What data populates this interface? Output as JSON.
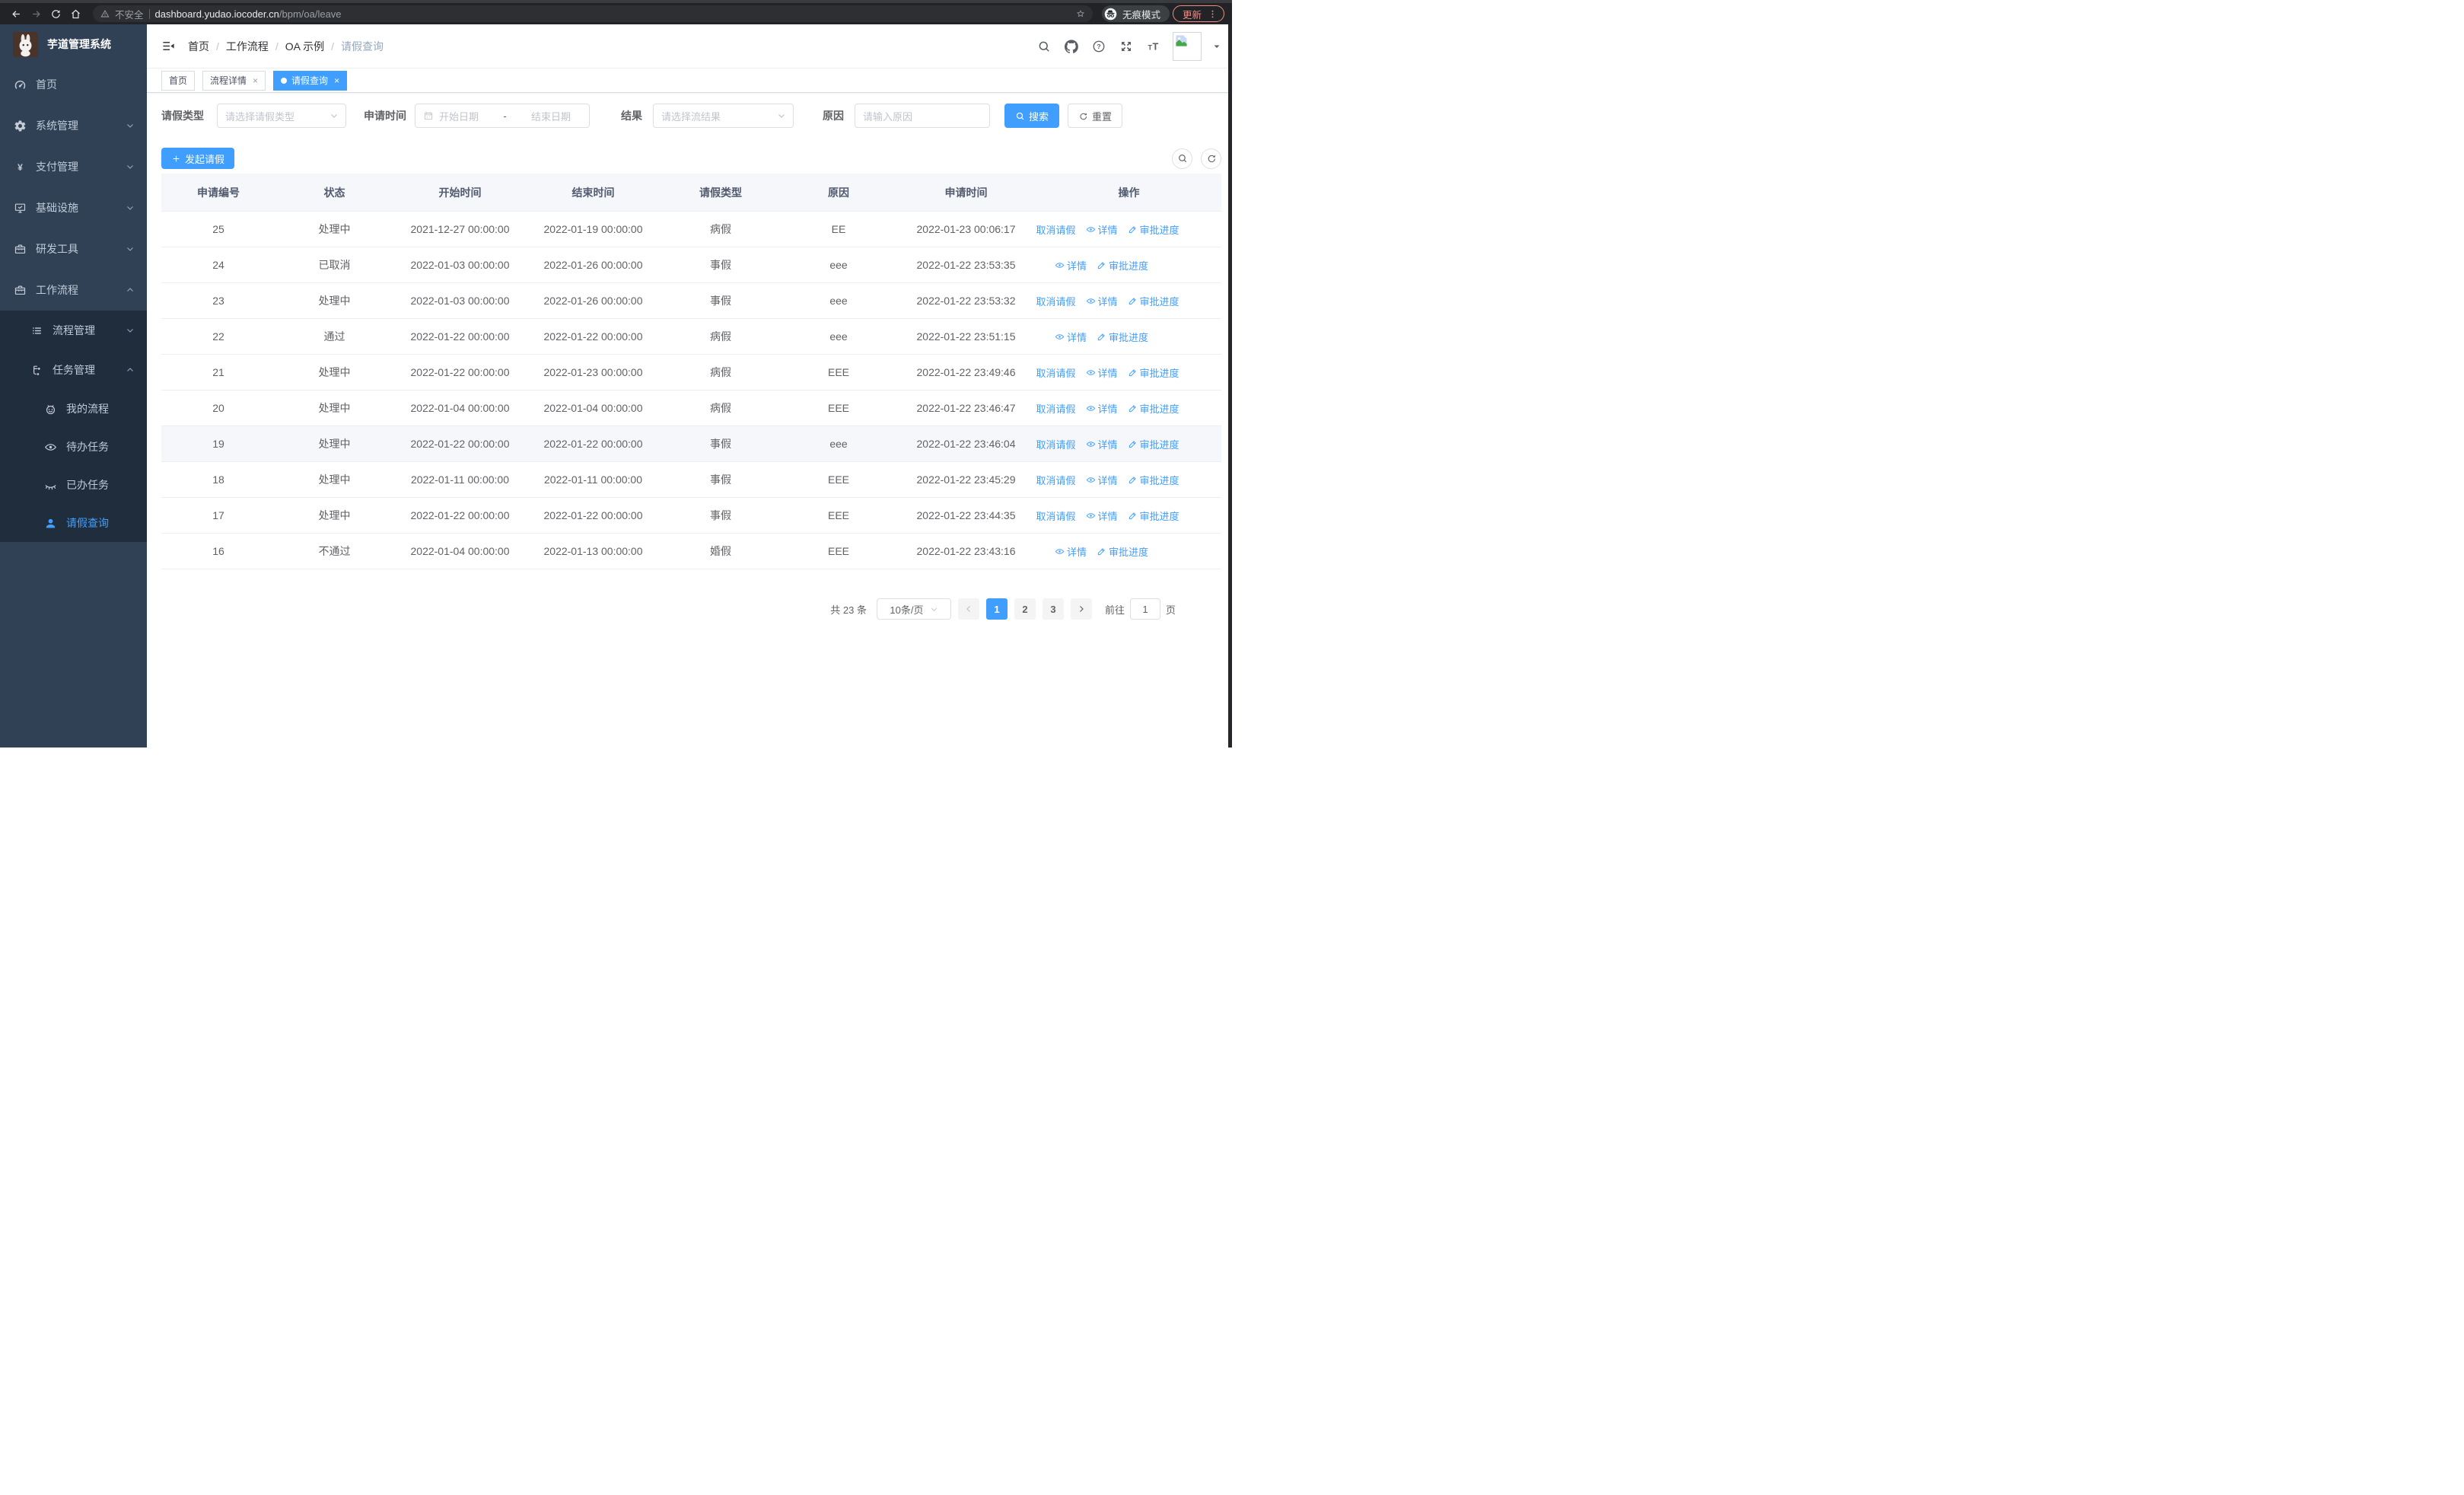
{
  "browser": {
    "security_label": "不安全",
    "url_host": "dashboard.yudao.iocoder.cn",
    "url_path": "/bpm/oa/leave",
    "incognito_label": "无痕模式",
    "update_label": "更新"
  },
  "sidebar": {
    "title": "芋道管理系统",
    "menu": [
      {
        "label": "首页",
        "icon": "dashboard-icon",
        "level": 1,
        "chevron": null,
        "insub": false,
        "active": false
      },
      {
        "label": "系统管理",
        "icon": "gear-icon",
        "level": 1,
        "chevron": "down",
        "insub": false,
        "active": false
      },
      {
        "label": "支付管理",
        "icon": "yen-icon",
        "level": 1,
        "chevron": "down",
        "insub": false,
        "active": false
      },
      {
        "label": "基础设施",
        "icon": "monitor-icon",
        "level": 1,
        "chevron": "down",
        "insub": false,
        "active": false
      },
      {
        "label": "研发工具",
        "icon": "toolbox-icon",
        "level": 1,
        "chevron": "down",
        "insub": false,
        "active": false
      },
      {
        "label": "工作流程",
        "icon": "toolbox-icon",
        "level": 1,
        "chevron": "up",
        "insub": false,
        "active": false
      },
      {
        "label": "流程管理",
        "icon": "list-icon",
        "level": 2,
        "chevron": "down",
        "insub": true,
        "active": false
      },
      {
        "label": "任务管理",
        "icon": "tree-icon",
        "level": 2,
        "chevron": "up",
        "insub": true,
        "active": false
      },
      {
        "label": "我的流程",
        "icon": "robot-icon",
        "level": 3,
        "chevron": null,
        "insub": true,
        "active": false
      },
      {
        "label": "待办任务",
        "icon": "eye-open-icon",
        "level": 3,
        "chevron": null,
        "insub": true,
        "active": false
      },
      {
        "label": "已办任务",
        "icon": "eye-closed-icon",
        "level": 3,
        "chevron": null,
        "insub": true,
        "active": false
      },
      {
        "label": "请假查询",
        "icon": "user-icon",
        "level": 3,
        "chevron": null,
        "insub": true,
        "active": true
      }
    ]
  },
  "navbar": {
    "breadcrumb": [
      "首页",
      "工作流程",
      "OA 示例",
      "请假查询"
    ],
    "icons": [
      "search-icon",
      "github-icon",
      "help-icon",
      "fullscreen-icon",
      "font-size-icon"
    ]
  },
  "tags": [
    {
      "label": "首页",
      "closable": false,
      "active": false
    },
    {
      "label": "流程详情",
      "closable": true,
      "active": false
    },
    {
      "label": "请假查询",
      "closable": true,
      "active": true
    }
  ],
  "filters": {
    "leave_type_label": "请假类型",
    "leave_type_placeholder": "请选择请假类型",
    "apply_time_label": "申请时间",
    "date_start_placeholder": "开始日期",
    "date_separator": "-",
    "date_end_placeholder": "结束日期",
    "result_label": "结果",
    "result_placeholder": "请选择流结果",
    "reason_label": "原因",
    "reason_placeholder": "请输入原因",
    "search_label": "搜索",
    "reset_label": "重置"
  },
  "toolbar": {
    "create_label": "发起请假"
  },
  "table": {
    "columns": [
      "申请编号",
      "状态",
      "开始时间",
      "结束时间",
      "请假类型",
      "原因",
      "申请时间",
      "操作"
    ],
    "action_labels": {
      "cancel": "取消请假",
      "detail": "详情",
      "progress": "审批进度"
    },
    "rows": [
      {
        "id": "25",
        "status": "处理中",
        "start": "2021-12-27 00:00:00",
        "end": "2022-01-19 00:00:00",
        "type": "病假",
        "reason": "EE",
        "apply_time": "2022-01-23 00:06:17",
        "actions": [
          "cancel",
          "detail",
          "progress"
        ],
        "highlighted": false
      },
      {
        "id": "24",
        "status": "已取消",
        "start": "2022-01-03 00:00:00",
        "end": "2022-01-26 00:00:00",
        "type": "事假",
        "reason": "eee",
        "apply_time": "2022-01-22 23:53:35",
        "actions": [
          "detail",
          "progress"
        ],
        "highlighted": false
      },
      {
        "id": "23",
        "status": "处理中",
        "start": "2022-01-03 00:00:00",
        "end": "2022-01-26 00:00:00",
        "type": "事假",
        "reason": "eee",
        "apply_time": "2022-01-22 23:53:32",
        "actions": [
          "cancel",
          "detail",
          "progress"
        ],
        "highlighted": false
      },
      {
        "id": "22",
        "status": "通过",
        "start": "2022-01-22 00:00:00",
        "end": "2022-01-22 00:00:00",
        "type": "病假",
        "reason": "eee",
        "apply_time": "2022-01-22 23:51:15",
        "actions": [
          "detail",
          "progress"
        ],
        "highlighted": false
      },
      {
        "id": "21",
        "status": "处理中",
        "start": "2022-01-22 00:00:00",
        "end": "2022-01-23 00:00:00",
        "type": "病假",
        "reason": "EEE",
        "apply_time": "2022-01-22 23:49:46",
        "actions": [
          "cancel",
          "detail",
          "progress"
        ],
        "highlighted": false
      },
      {
        "id": "20",
        "status": "处理中",
        "start": "2022-01-04 00:00:00",
        "end": "2022-01-04 00:00:00",
        "type": "病假",
        "reason": "EEE",
        "apply_time": "2022-01-22 23:46:47",
        "actions": [
          "cancel",
          "detail",
          "progress"
        ],
        "highlighted": false
      },
      {
        "id": "19",
        "status": "处理中",
        "start": "2022-01-22 00:00:00",
        "end": "2022-01-22 00:00:00",
        "type": "事假",
        "reason": "eee",
        "apply_time": "2022-01-22 23:46:04",
        "actions": [
          "cancel",
          "detail",
          "progress"
        ],
        "highlighted": true
      },
      {
        "id": "18",
        "status": "处理中",
        "start": "2022-01-11 00:00:00",
        "end": "2022-01-11 00:00:00",
        "type": "事假",
        "reason": "EEE",
        "apply_time": "2022-01-22 23:45:29",
        "actions": [
          "cancel",
          "detail",
          "progress"
        ],
        "highlighted": false
      },
      {
        "id": "17",
        "status": "处理中",
        "start": "2022-01-22 00:00:00",
        "end": "2022-01-22 00:00:00",
        "type": "事假",
        "reason": "EEE",
        "apply_time": "2022-01-22 23:44:35",
        "actions": [
          "cancel",
          "detail",
          "progress"
        ],
        "highlighted": false
      },
      {
        "id": "16",
        "status": "不通过",
        "start": "2022-01-04 00:00:00",
        "end": "2022-01-13 00:00:00",
        "type": "婚假",
        "reason": "EEE",
        "apply_time": "2022-01-22 23:43:16",
        "actions": [
          "detail",
          "progress"
        ],
        "highlighted": false
      }
    ]
  },
  "pagination": {
    "total_label": "共 23 条",
    "page_size": "10条/页",
    "pages": [
      "1",
      "2",
      "3"
    ],
    "current_page": "1",
    "goto_label": "前往",
    "goto_value": "1",
    "page_unit": "页"
  },
  "colors": {
    "accent": "#409eff",
    "sidebar_bg": "#304156",
    "submenu_bg": "#1f2d3d",
    "tag_active": "#409eff",
    "update_chip": "#f28b82"
  }
}
